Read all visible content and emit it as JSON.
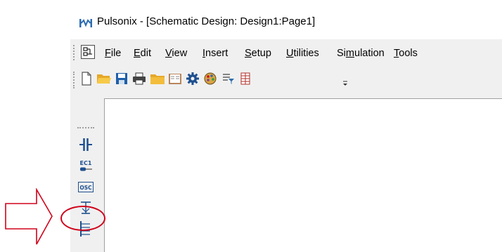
{
  "window": {
    "title": "Pulsonix - [Schematic Design: Design1:Page1]",
    "app_icon": "pulsonix-logo-icon"
  },
  "menubar": {
    "doc_icon": "document-control-icon",
    "items": [
      {
        "label": "File",
        "mnemonic": "F",
        "rest": "ile"
      },
      {
        "label": "Edit",
        "mnemonic": "E",
        "rest": "dit"
      },
      {
        "label": "View",
        "mnemonic": "V",
        "rest": "iew"
      },
      {
        "label": "Insert",
        "mnemonic": "I",
        "rest": "nsert"
      },
      {
        "label": "Setup",
        "mnemonic": "S",
        "rest": "etup"
      },
      {
        "label": "Utilities",
        "mnemonic": "U",
        "rest": "tilities"
      },
      {
        "label": "Simulation",
        "pre": "Si",
        "mnemonic": "m",
        "rest": "ulation"
      },
      {
        "label": "Tools",
        "mnemonic": "T",
        "rest": "ools"
      }
    ]
  },
  "toolbar": {
    "buttons": [
      "new-document-icon",
      "open-folder-icon",
      "save-disk-icon",
      "print-icon",
      "folder-icon",
      "book-icon",
      "settings-gear-icon",
      "color-palette-icon",
      "filter-icon",
      "library-grid-icon"
    ],
    "overflow": "toolbar-overflow-chevron-icon"
  },
  "sidebar": {
    "buttons": [
      "capacitor-icon",
      "ec1-component-icon",
      "osc-component-icon",
      "ground-symbol-icon",
      "bus-lines-icon"
    ],
    "ec1_label": "EC1",
    "osc_label": "OSC"
  },
  "annotations": {
    "arrow_color": "#d0021b",
    "highlight_target": "ground-symbol-icon"
  }
}
